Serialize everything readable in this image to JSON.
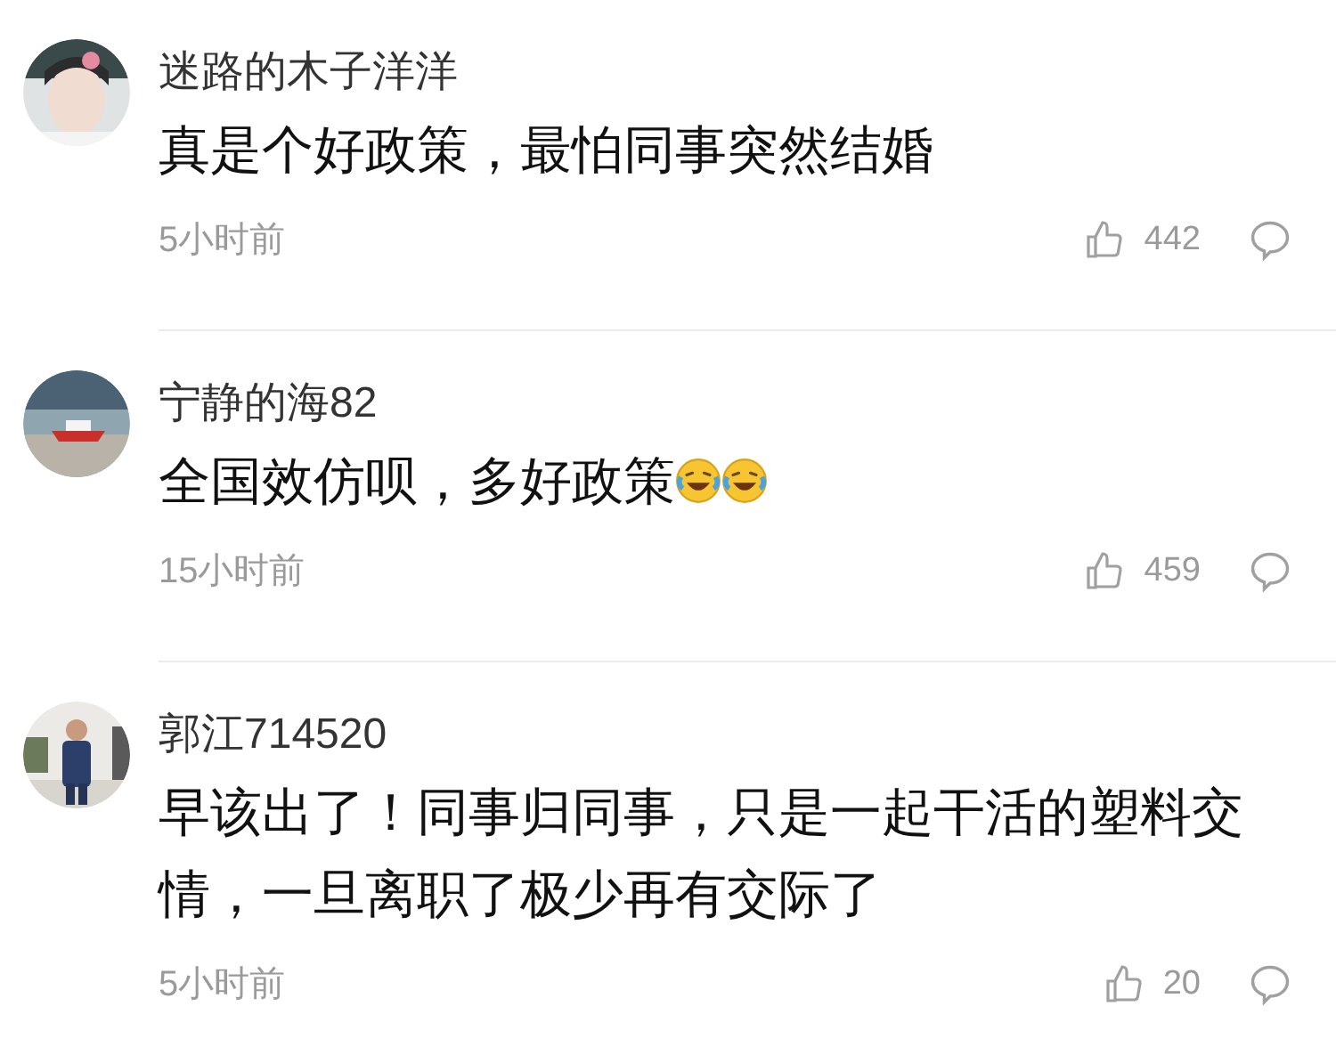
{
  "comments": [
    {
      "avatar": {
        "kind": "picture"
      },
      "username": "迷路的木子洋洋",
      "text": "真是个好政策，最怕同事突然结婚",
      "time": "5小时前",
      "likes": "442"
    },
    {
      "avatar": {
        "kind": "picture"
      },
      "username": "宁静的海82",
      "text": "全国效仿呗，多好政策",
      "emojis": [
        {
          "kind": "laughing-emoji"
        },
        {
          "kind": "laughing-emoji"
        }
      ],
      "time": "15小时前",
      "likes": "459"
    },
    {
      "avatar": {
        "kind": "picture"
      },
      "username": "郭江714520",
      "text": "早该出了！同事归同事，只是一起干活的塑料交情，一旦离职了极少再有交际了",
      "time": "5小时前",
      "likes": "20"
    }
  ]
}
